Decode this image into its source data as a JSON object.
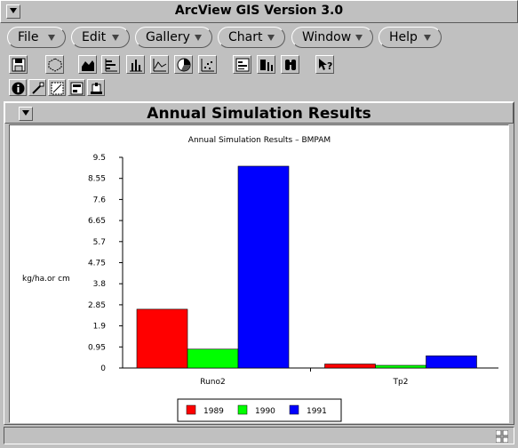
{
  "app": {
    "title": "ArcView GIS Version 3.0"
  },
  "menus": [
    {
      "label": "File"
    },
    {
      "label": "Edit"
    },
    {
      "label": "Gallery"
    },
    {
      "label": "Chart"
    },
    {
      "label": "Window"
    },
    {
      "label": "Help"
    }
  ],
  "toolbar_icons": [
    "save-icon",
    "properties-icon",
    "area-chart-icon",
    "bar-chart-horizontal-icon",
    "column-chart-icon",
    "line-chart-icon",
    "pie-chart-icon",
    "scatter-chart-icon",
    "chart-element-properties-icon",
    "series-from-records-icon",
    "find-icon",
    "help-icon"
  ],
  "tool_icons": [
    "identify-icon",
    "erase-icon",
    "marker-icon",
    "title-icon",
    "axis-icon"
  ],
  "document": {
    "title": "Annual Simulation Results"
  },
  "chart_data": {
    "type": "bar",
    "title": "Annual Simulation Results – BMPAM",
    "ylabel": "kg/ha.or cm",
    "xlabel": "",
    "categories": [
      "Runo2",
      "Tp2"
    ],
    "ylim": [
      0,
      9.5
    ],
    "yticks": [
      "0",
      "0.95",
      "1.9",
      "2.85",
      "3.8",
      "4.75",
      "5.7",
      "6.65",
      "7.6",
      "8.55",
      "9.5"
    ],
    "series": [
      {
        "name": "1989",
        "color": "#ff0000",
        "values": [
          2.65,
          0.18
        ]
      },
      {
        "name": "1990",
        "color": "#00ff00",
        "values": [
          0.85,
          0.12
        ]
      },
      {
        "name": "1991",
        "color": "#0000ff",
        "values": [
          9.1,
          0.55
        ]
      }
    ],
    "legend": "bottom",
    "grid": false
  }
}
